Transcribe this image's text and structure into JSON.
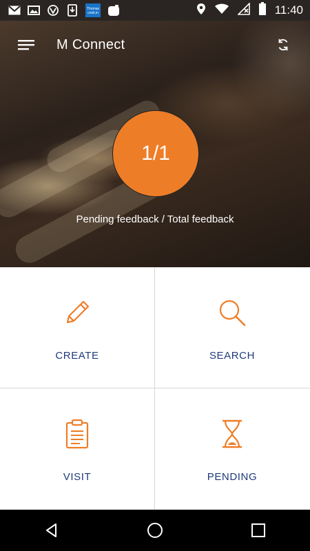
{
  "status_bar": {
    "time": "11:40",
    "notification_icons": [
      "gmail-icon",
      "photos-icon",
      "vpn-shield-icon",
      "phone-download-icon",
      "thomas-cook-icon",
      "app-icon"
    ],
    "system_icons": [
      "location-icon",
      "wifi-icon",
      "no-sim-icon",
      "battery-icon"
    ],
    "thomas_cook_text": "Thomas cook.in"
  },
  "app_bar": {
    "title": "M Connect"
  },
  "summary": {
    "count_text": "1/1",
    "caption": "Pending feedback / Total feedback",
    "accent_color": "#ee7d27"
  },
  "tiles": [
    {
      "label": "CREATE",
      "icon": "pencil-icon"
    },
    {
      "label": "SEARCH",
      "icon": "search-icon"
    },
    {
      "label": "VISIT",
      "icon": "clipboard-icon"
    },
    {
      "label": "PENDING",
      "icon": "hourglass-icon"
    }
  ],
  "colors": {
    "tile_label": "#1e3a78",
    "icon_orange": "#ee7d27"
  },
  "nav_bar": [
    "back-icon",
    "home-icon",
    "recents-icon"
  ]
}
